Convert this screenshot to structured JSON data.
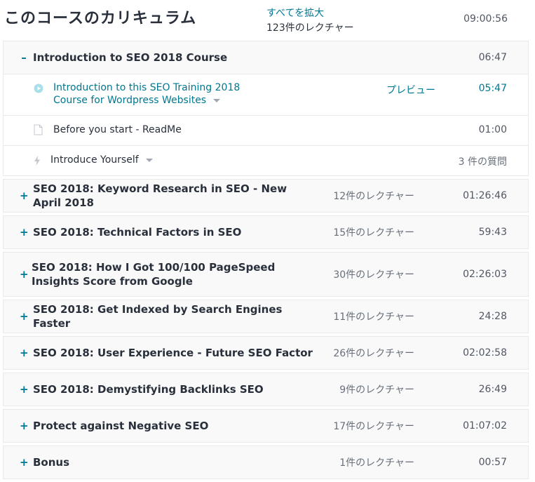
{
  "curriculum": {
    "title": "このコースのカリキュラム",
    "expand_all": "すべてを拡大",
    "total_lectures": "123件のレクチャー",
    "total_time": "09:00:56"
  },
  "open_section": {
    "toggle": "–",
    "title": "Introduction to SEO 2018 Course",
    "time": "06:47",
    "lectures": [
      {
        "title_line1": "Introduction to this SEO Training 2018",
        "title_line2": "Course for Wordpress Websites",
        "preview": "プレビュー",
        "time": "05:47",
        "icon": "play-circle-icon"
      },
      {
        "title": "Before you start - ReadMe",
        "time": "01:00",
        "icon": "document-icon"
      },
      {
        "title": "Introduce Yourself",
        "time": "3 件の質問",
        "icon": "lightning-icon"
      }
    ]
  },
  "sections": [
    {
      "toggle": "+",
      "title": "SEO 2018: Keyword Research in SEO - New April 2018",
      "count": "12件のレクチャー",
      "time": "01:26:46"
    },
    {
      "toggle": "+",
      "title": "SEO 2018: Technical Factors in SEO",
      "count": "15件のレクチャー",
      "time": "59:43"
    },
    {
      "toggle": "+",
      "title": "SEO 2018: How I Got 100/100 PageSpeed Insights Score from Google",
      "count": "30件のレクチャー",
      "time": "02:26:03"
    },
    {
      "toggle": "+",
      "title": "SEO 2018: Get Indexed by Search Engines Faster",
      "count": "11件のレクチャー",
      "time": "24:28"
    },
    {
      "toggle": "+",
      "title": "SEO 2018: User Experience - Future SEO Factor",
      "count": "26件のレクチャー",
      "time": "02:02:58"
    },
    {
      "toggle": "+",
      "title": "SEO 2018: Demystifying Backlinks SEO",
      "count": "9件のレクチャー",
      "time": "26:49"
    },
    {
      "toggle": "+",
      "title": "Protect against Negative SEO",
      "count": "17件のレクチャー",
      "time": "01:07:02"
    },
    {
      "toggle": "+",
      "title": "Bonus",
      "count": "1件のレクチャー",
      "time": "00:57"
    }
  ],
  "colors": {
    "accent": "#007791",
    "text": "#29303b",
    "border": "#e8e9eb",
    "section_bg": "#f9f9f9"
  }
}
